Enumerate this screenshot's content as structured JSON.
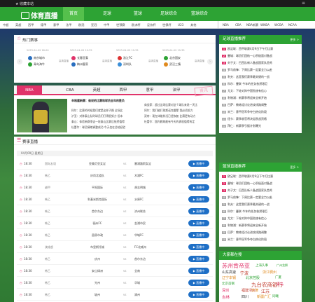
{
  "topbar": {
    "favorite": "收藏本站"
  },
  "brand": {
    "name": "体育直播"
  },
  "nav": [
    "首页",
    "足球",
    "篮球",
    "足球综合",
    "篮球综合"
  ],
  "subnav_left": [
    "中超",
    "英超",
    "西甲",
    "德甲",
    "意甲",
    "法甲",
    "欧冠",
    "亚冠",
    "中甲",
    "世预赛",
    "欧洲杯",
    "足协杯",
    "世俱杯",
    "U23",
    "其他"
  ],
  "subnav_right": [
    "NBA",
    "CBA",
    "NBA新赛",
    "WNBA",
    "WCBA",
    "NCAA"
  ],
  "hot": {
    "title": "热门赛事",
    "matches": [
      {
        "time": "2023-04-09 18:00",
        "home": "南京城市",
        "away": "青岛海牛",
        "status": "高清直播"
      },
      {
        "time": "2023-04-09 19:35",
        "home": "长春亚泰",
        "away": "梅州客家",
        "status": "高清直播"
      },
      {
        "time": "2023-04-09 19:35",
        "home": "浙江FC",
        "away": "深圳队",
        "status": "高清直播"
      },
      {
        "time": "2023-04-09 19:35",
        "home": "北京国安",
        "away": "武汉三镇",
        "status": "高清直播"
      }
    ]
  },
  "news": {
    "tabs": [
      "NBA",
      "CBA",
      "英超",
      "西甲",
      "意甲",
      "法甲"
    ],
    "stamp": "资讯",
    "headline": "辛格建新赛：谁说的比赛和球员全年的胜负",
    "lines_mid": [
      "科尔：比赛的时候我们就是这样子踢 全场比",
      "沪亚：对阵泰山队时球员们打得很努力 但本",
      "泰山：体验新赛季这一轮泰山比赛后依然值得",
      "杜蕾尔：球员情绪调整成功 今天也在总结经验"
    ],
    "lines_right": [
      "商战家：超过这场比赛对这个球队来说一天比",
      "阿尔：我们能打败斯诺克雷蒙 我必须努力",
      "双帝：现在体能状况已经恢复 比赛更有动力",
      "杜蕾尔：国内教练能有今天的表现值得肯定"
    ]
  },
  "live": {
    "title": "赛事直播",
    "date": "04月09日 星期日",
    "btn": "直播中",
    "rows": [
      {
        "time": "18:30",
        "league": "国际友谊",
        "home": "亚美尼亚女足",
        "away": "塞浦路斯女足"
      },
      {
        "time": "18:30",
        "league": "韩乙",
        "home": "庆尚北道队",
        "away": "木浦FC"
      },
      {
        "time": "18:30",
        "league": "越甲",
        "home": "平阳国际",
        "away": "胡志明城"
      },
      {
        "time": "18:30",
        "league": "韩乙",
        "home": "利基米斯克国际",
        "away": "水原FC"
      },
      {
        "time": "18:30",
        "league": "韩乙",
        "home": "首尔东边",
        "away": "济州联合"
      },
      {
        "time": "18:30",
        "league": "韩乙",
        "home": "骊州FC",
        "away": "金浦市民"
      },
      {
        "time": "18:30",
        "league": "韩乙",
        "home": "昌原市政",
        "away": "华城FC"
      },
      {
        "time": "18:30",
        "league": "澳维超",
        "home": "布里斯托城",
        "away": "FC北威州"
      },
      {
        "time": "18:30",
        "league": "韩乙",
        "home": "庆州",
        "away": "首尔东边"
      },
      {
        "time": "18:30",
        "league": "韩乙",
        "home": "安山绿洲",
        "away": "全南"
      },
      {
        "time": "18:30",
        "league": "韩乙",
        "home": "光州",
        "away": "华城"
      },
      {
        "time": "18:30",
        "league": "韩乙",
        "home": "坡州",
        "away": "清州"
      }
    ]
  },
  "side1": {
    "title": "足球直播推荐",
    "more": "更多 >",
    "items": [
      "欧足联：西甲联赛4月9日下午打比赛",
      "曼城：球员们团结一心积极面对备战",
      "刘子文：巴西队新人备战国家队首秀",
      "罗马前锋：下周比赛一定要全力以赴",
      "利夫：这是我们赛季最关键的一战",
      "科尔：曼联 今年的任务依然艰巨",
      "尤文：下轮对阵中国劲旅有信心",
      "利物浦：新赛季将迎来全新开始",
      "巴萨：教练组讨论进攻线路调整",
      "米兰：意甲冠军争夺白热化阶段",
      "纽卡：赛季收官将决定欧战资格",
      "拜仁：新赛季引援计划曝光"
    ]
  },
  "side2": {
    "title": "篮球直播推荐",
    "more": "更多 >",
    "items": [
      "欧足联：西甲联赛4月9日下午打比赛",
      "曼城：球员们团结一心积极面对备战",
      "刘子文：巴西队新人备战国家队首秀",
      "罗马前锋：下周比赛一定要全力以赴",
      "利夫：这是我们赛季最关键的一战",
      "科尔：曼联 今年的任务依然艰巨",
      "尤文：下轮对阵中国劲旅有信心",
      "利物浦：新赛季将迎来全新开始",
      "巴萨：教练组讨论进攻线路调整",
      "米兰：意甲冠军争夺白热化阶段",
      "纽卡：赛季收官将决定欧战资格",
      "拜仁：新赛季引援计划曝光"
    ]
  },
  "side3": {
    "title": "大家都在搜",
    "tags": [
      "苏州肯帝亚",
      "上海久事",
      "广州龙狮",
      "山东高速",
      "宁波",
      "浙江稠州",
      "辽宁本钢",
      "北京控股",
      "广厦",
      "北京首钢",
      "九台农商银行",
      "青岛",
      "深圳",
      "福建浔兴",
      "天津",
      "江苏",
      "吉林",
      "四川",
      "新疆广汇",
      "同曦"
    ]
  },
  "colors": {
    "green": "#2da334",
    "pink": "#e0336a",
    "blue": "#1e6fc6"
  }
}
